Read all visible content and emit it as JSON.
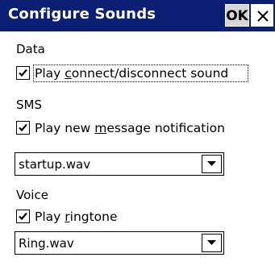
{
  "window": {
    "title": "Configure Sounds",
    "ok_label": "OK",
    "title_bar_color": "#0a1f73"
  },
  "data_section": {
    "label": "Data",
    "checkbox": {
      "pre": "Play ",
      "underlined": "c",
      "post": "onnect/disconnect sound",
      "checked": true
    }
  },
  "sms_section": {
    "label": "SMS",
    "checkbox": {
      "pre": "Play new ",
      "underlined": "m",
      "post": "essage notification",
      "checked": true
    },
    "dropdown_value": "startup.wav"
  },
  "voice_section": {
    "label": "Voice",
    "checkbox": {
      "pre": "Play ",
      "underlined": "r",
      "post": "ingtone",
      "checked": true
    },
    "dropdown_value": "Ring.wav"
  },
  "icons": {
    "close": "close-icon",
    "check": "checkmark-icon",
    "dropdown": "dropdown-arrow-icon"
  }
}
